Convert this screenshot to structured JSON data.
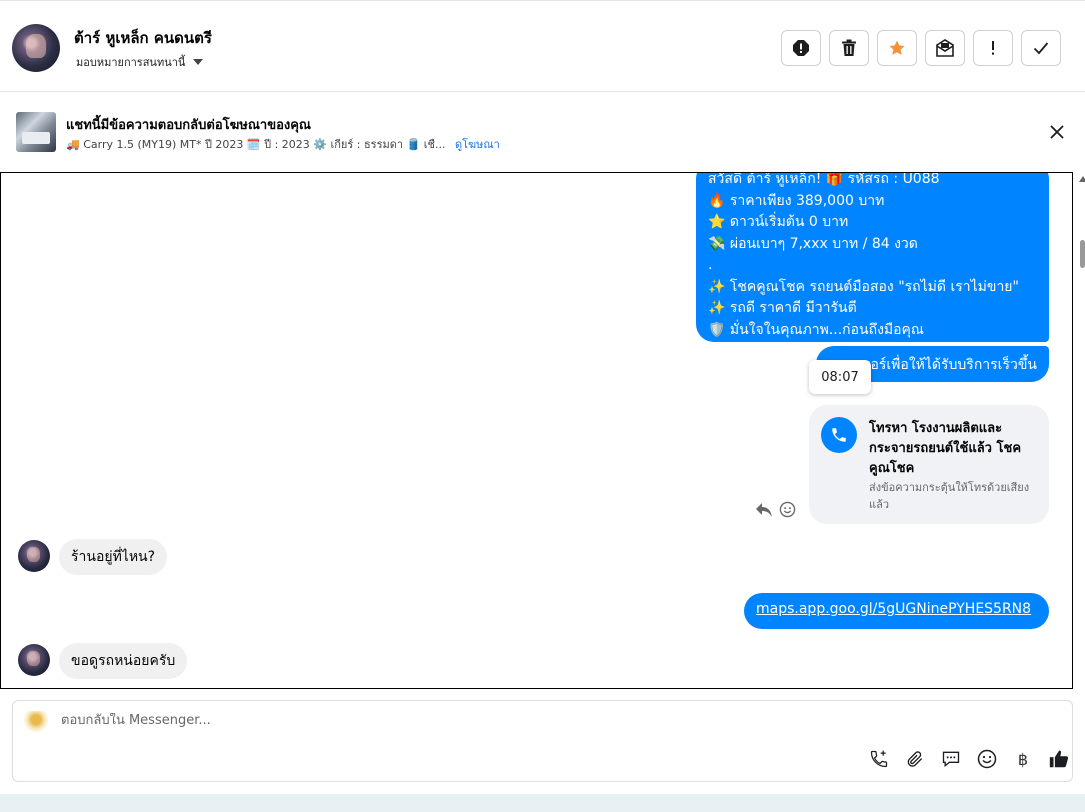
{
  "header": {
    "contact_name": "ต้าร์ หูเหล็ก คนดนตรี",
    "assign_label": "มอบหมายการสนทนานี้",
    "actions": [
      "spam-icon",
      "trash-icon",
      "star-icon",
      "mail-icon",
      "important-icon",
      "check-icon"
    ],
    "star_color": "#f7923b"
  },
  "ad": {
    "title": "แชทนี้มีข้อความตอบกลับต่อโฆษณาของคุณ",
    "details": "🚚 Carry 1.5 (MY19) MT* ปี 2023 🗓️ ปี : 2023 ⚙️ เกียร์ : ธรรมดา 🛢️ เชื...",
    "link": "ดูโฆษณา"
  },
  "messages": {
    "promo_lines": [
      "สวัสดี ต้าร์ หูเหล็ก! 🎁 รหัสรถ : U088",
      "🔥 ราคาเพียง 389,000 บาท",
      "⭐ ดาวน์เริ่มต้น 0 บาท",
      "💸 ผ่อนเบาๆ 7,xxx บาท / 84 งวด",
      ".",
      "✨ โชคคูณโชค รถยนต์มือสอง \"รถไม่ดี เราไม่ขาย\"",
      "✨ รถดี ราคาดี มีวารันตี",
      "🛡️ มั่นใจในคุณภาพ...ก่อนถึงมือคุณ"
    ],
    "quick_reply": "ขอเบอร์เพื่อให้ได้รับบริการเร็วขึ้น",
    "tooltip_time": "08:07",
    "call_card": {
      "title": "โทรหา โรงงานผลิตและกระจายรถยนต์ใช้แล้ว โชคคูณโชค",
      "subtitle": "ส่งข้อความกระตุ้นให้โทรด้วยเสียงแล้ว"
    },
    "incoming_1": "ร้านอยู่ที่ไหน?",
    "link_message": "maps.app.goo.gl/5gUGNinePYHES5RN8",
    "incoming_2": "ขอดูรถหน่อยครับ"
  },
  "composer": {
    "placeholder": "ตอบกลับใน Messenger...",
    "tools": [
      "call-add-icon",
      "paperclip-icon",
      "saved-reply-icon",
      "emoji-icon",
      "baht-icon",
      "like-icon"
    ],
    "baht_symbol": "฿"
  },
  "colors": {
    "accent": "#0084ff",
    "link": "#1b74e4"
  }
}
